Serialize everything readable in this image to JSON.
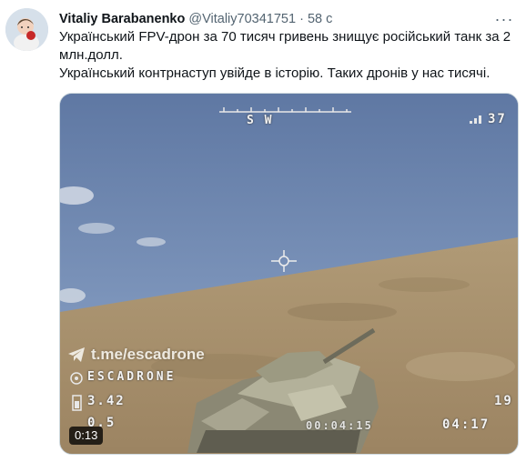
{
  "tweet": {
    "author_name": "Vitaliy Barabanenko",
    "handle": "@Vitaliy70341751",
    "separator": "·",
    "time": "58 с",
    "more_glyph": "···",
    "text_line1": "Український FPV-дрон за 70 тисяч гривень знищує російський танк за 2 млн.долл.",
    "text_line2": "Український контрнаступ увійде в історію. Таких дронів у нас тисячі."
  },
  "video": {
    "duration": "0:13",
    "watermark": "t.me/escadrone",
    "osd": {
      "compass": "S        W",
      "signal": "37",
      "callsign": "ESCADRONE",
      "voltage": "3.42",
      "value2": "0.5",
      "right_value": "19",
      "timer": "04:17",
      "bottom_mid": "00:04:15"
    }
  },
  "colors": {
    "name": "#0f1419",
    "secondary": "#536471",
    "border": "#cfd9de",
    "sky": "#6e86ac",
    "ground": "#a9906a"
  }
}
